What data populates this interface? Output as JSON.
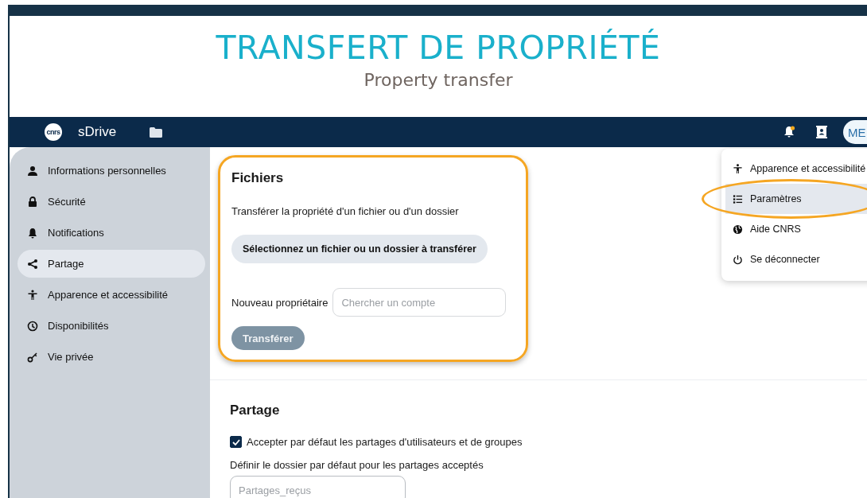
{
  "header": {
    "title": "TRANSFERT DE PROPRIÉTÉ",
    "subtitle": "Property transfer"
  },
  "navbar": {
    "logo": "cnrs",
    "app_name": "sDrive",
    "notification_dot": true,
    "avatar": "ME"
  },
  "sidebar": {
    "items": [
      {
        "label": "Informations personnelles",
        "kind": "person",
        "selected": false
      },
      {
        "label": "Sécurité",
        "kind": "lock",
        "selected": false
      },
      {
        "label": "Notifications",
        "kind": "bell",
        "selected": false
      },
      {
        "label": "Partage",
        "kind": "share",
        "selected": true
      },
      {
        "label": "Apparence et accessibilité",
        "kind": "access",
        "selected": false
      },
      {
        "label": "Disponibilités",
        "kind": "clock",
        "selected": false
      },
      {
        "label": "Vie privée",
        "kind": "key",
        "selected": false
      }
    ]
  },
  "files_section": {
    "title": "Fichiers",
    "description": "Transférer la propriété d'un fichier ou d'un dossier",
    "select_button": "Sélectionnez un fichier ou un dossier à transférer",
    "owner_label": "Nouveau propriétaire",
    "owner_placeholder": "Chercher un compte",
    "transfer_button": "Transférer",
    "transfer_disabled": true,
    "highlighted": true
  },
  "sharing_section": {
    "title": "Partage",
    "accept_label": "Accepter par défaut les partages d'utilisateurs et de groupes",
    "accept_checked": true,
    "folder_label": "Définir le dossier par défaut pour les partages acceptés",
    "folder_placeholder": "Partages_reçus"
  },
  "user_menu": {
    "items": [
      {
        "label": "Apparence et accessibilité",
        "kind": "access",
        "selected": false,
        "highlighted": false
      },
      {
        "label": "Paramètres",
        "kind": "list",
        "selected": true,
        "highlighted": true
      },
      {
        "label": "Aide CNRS",
        "kind": "globe",
        "selected": false,
        "highlighted": false
      },
      {
        "label": "Se déconnecter",
        "kind": "power",
        "selected": false,
        "highlighted": false
      }
    ]
  }
}
